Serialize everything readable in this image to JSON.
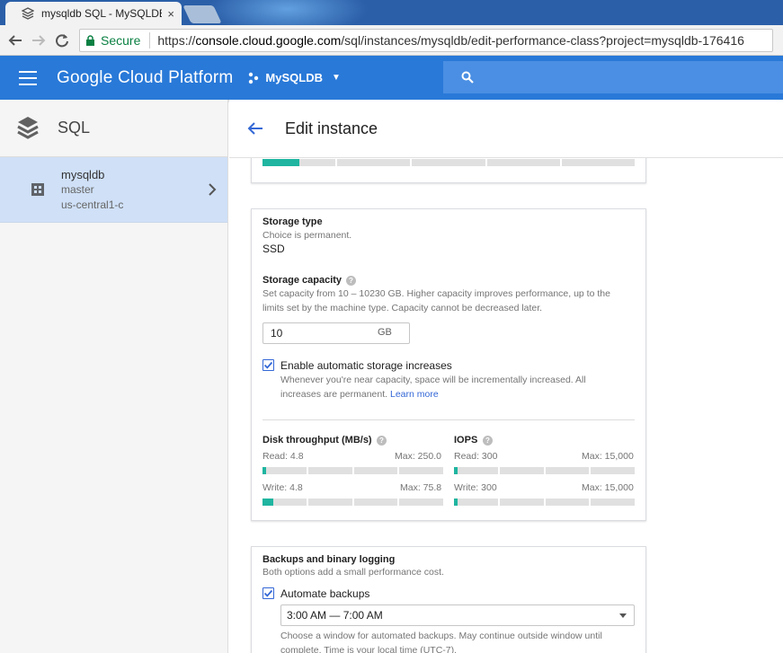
{
  "browser": {
    "tab_title": "mysqldb SQL - MySQLDB",
    "tab_close": "×",
    "secure_label": "Secure",
    "url_scheme": "https://",
    "url_domain": "console.cloud.google.com",
    "url_path": "/sql/instances/mysqldb/edit-performance-class?project=mysqldb-176416"
  },
  "header": {
    "title": "Google Cloud Platform",
    "project": "MySQLDB",
    "accent": "#2979d8"
  },
  "sidebar": {
    "title": "SQL",
    "instance": {
      "name": "mysqldb",
      "role": "master",
      "zone": "us-central1-c"
    }
  },
  "main": {
    "title": "Edit instance",
    "storage": {
      "type_label": "Storage type",
      "type_note": "Choice is permanent.",
      "type_value": "SSD",
      "capacity_label": "Storage capacity",
      "capacity_desc_1": "Set capacity from 10 – 10230 GB. Higher capacity improves performance, up to the",
      "capacity_desc_2": "limits set by the machine type. Capacity cannot be decreased later.",
      "capacity_value": "10",
      "capacity_unit": "GB",
      "auto_label": "Enable automatic storage increases",
      "auto_desc_1": "Whenever you're near capacity, space will be incrementally increased. All",
      "auto_desc_2": "increases are permanent.",
      "auto_link": "Learn more",
      "throughput_label": "Disk throughput (MB/s)",
      "iops_label": "IOPS",
      "tp_read": "Read: 4.8",
      "tp_read_max": "Max: 250.0",
      "tp_write": "Write: 4.8",
      "tp_write_max": "Max: 75.8",
      "iops_read": "Read: 300",
      "iops_read_max": "Max: 15,000",
      "iops_write": "Write: 300",
      "iops_write_max": "Max: 15,000",
      "bars": {
        "top": 0.1,
        "tp_read": 0.02,
        "tp_write": 0.06,
        "iops_read": 0.02,
        "iops_write": 0.02
      }
    },
    "backups": {
      "title": "Backups and binary logging",
      "desc": "Both options add a small performance cost.",
      "auto_label": "Automate backups",
      "window_value": "3:00 AM — 7:00 AM",
      "window_desc_1": "Choose a window for automated backups. May continue outside window until",
      "window_desc_2": "complete. Time is your local time (UTC-7)."
    }
  }
}
